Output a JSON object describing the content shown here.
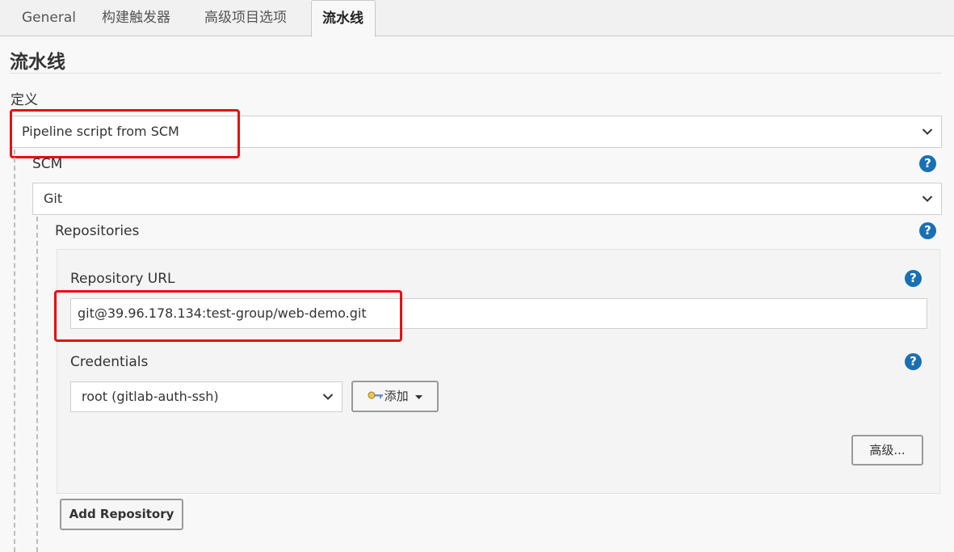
{
  "tabs": [
    {
      "label": "General",
      "active": false
    },
    {
      "label": "构建触发器",
      "active": false
    },
    {
      "label": "高级项目选项",
      "active": false
    },
    {
      "label": "流水线",
      "active": true
    }
  ],
  "section": {
    "title": "流水线"
  },
  "definition": {
    "label": "定义",
    "selected": "Pipeline script from SCM"
  },
  "scm": {
    "label": "SCM",
    "selected": "Git",
    "help": "?"
  },
  "repositories": {
    "label": "Repositories",
    "help": "?",
    "repo_url": {
      "label": "Repository URL",
      "value": "git@39.96.178.134:test-group/web-demo.git",
      "help": "?"
    },
    "credentials": {
      "label": "Credentials",
      "selected": "root (gitlab-auth-ssh)",
      "add_label": "添加",
      "help": "?"
    },
    "advanced_label": "高级...",
    "add_repository_label": "Add Repository"
  },
  "colors": {
    "help_blue": "#1a6fb2",
    "highlight_red": "#e60f0f"
  }
}
